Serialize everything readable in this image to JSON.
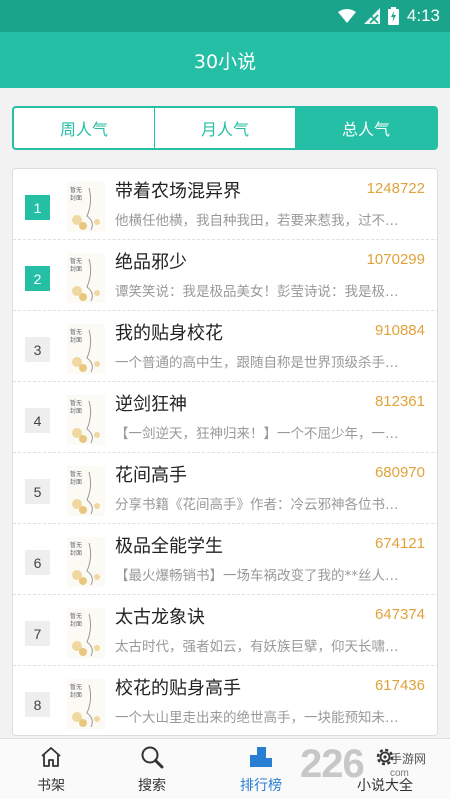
{
  "status": {
    "time": "4:13"
  },
  "app": {
    "title": "30小说"
  },
  "tabs": [
    {
      "label": "周人气",
      "active": false
    },
    {
      "label": "月人气",
      "active": false
    },
    {
      "label": "总人气",
      "active": true
    }
  ],
  "books": [
    {
      "rank": "1",
      "title": "带着农场混异界",
      "count": "1248722",
      "desc": "他横任他横，我自种我田，若要来惹我，过不…"
    },
    {
      "rank": "2",
      "title": "绝品邪少",
      "count": "1070299",
      "desc": "谭笑笑说：我是极品美女！彭莹诗说：我是极…"
    },
    {
      "rank": "3",
      "title": "我的贴身校花",
      "count": "910884",
      "desc": "一个普通的高中生，跟随自称是世界顶级杀手…"
    },
    {
      "rank": "4",
      "title": "逆剑狂神",
      "count": "812361",
      "desc": "【一剑逆天，狂神归来！】一个不屈少年，一…"
    },
    {
      "rank": "5",
      "title": "花间高手",
      "count": "680970",
      "desc": "分享书籍《花间高手》作者：冷云邪神各位书…"
    },
    {
      "rank": "6",
      "title": "极品全能学生",
      "count": "674121",
      "desc": "【最火爆畅销书】一场车祸改变了我的**丝人…"
    },
    {
      "rank": "7",
      "title": "太古龙象诀",
      "count": "647374",
      "desc": "太古时代，强者如云，有妖族巨擘，仰天长啸…"
    },
    {
      "rank": "8",
      "title": "校花的贴身高手",
      "count": "617436",
      "desc": "一个大山里走出来的绝世高手，一块能预知未…"
    }
  ],
  "nav": [
    {
      "label": "书架",
      "icon": "home-icon"
    },
    {
      "label": "搜索",
      "icon": "search-icon"
    },
    {
      "label": "排行榜",
      "icon": "ranking-icon",
      "active": true
    },
    {
      "label": "小说大全",
      "icon": "gear-icon"
    }
  ],
  "watermark": {
    "number": "226",
    "cn": "手游网",
    "url": "com"
  },
  "colors": {
    "primary": "#24bfa5",
    "statusbar": "#1ba48c",
    "count": "#e0a23b",
    "nav_active": "#2a7fd4"
  }
}
